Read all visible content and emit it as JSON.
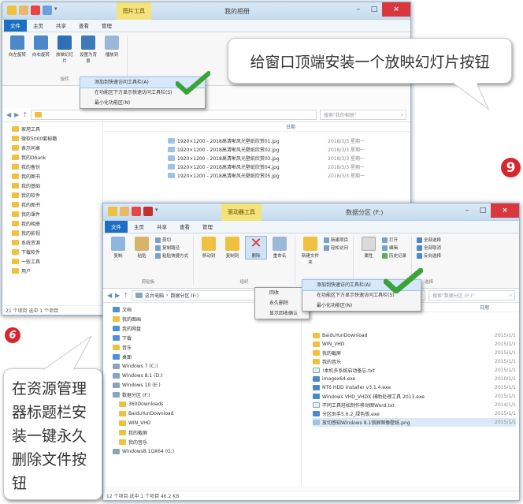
{
  "back_window": {
    "tool_tab": "图片工具",
    "title": "我的相册",
    "tabs": [
      "文件",
      "主页",
      "共享",
      "查看",
      "管理"
    ],
    "ribbon_buttons": [
      {
        "label": "向左旋转",
        "icon": "rotate-left-icon"
      },
      {
        "label": "向右旋转",
        "icon": "rotate-right-icon"
      },
      {
        "label": "放映幻灯片",
        "icon": "slideshow-icon"
      },
      {
        "label": "设置为背景",
        "icon": "set-background-icon"
      },
      {
        "label": "播放到",
        "icon": "play-to-icon"
      }
    ],
    "ribbon_group": "旋转",
    "context_menu": [
      "添加到快速访问工具栏(A)",
      "在功能区下方显示快速访问工具栏(S)",
      "最小化功能区(N)"
    ],
    "search_placeholder": "搜索\"我的相册\"",
    "date_header": "日期",
    "nav_items": [
      "家用工具",
      "微软5000套秘籍",
      "表示同桌",
      "我的Dbank",
      "我的备份",
      "我的图书",
      "我的基础",
      "我的软件",
      "我的图书",
      "我的课件",
      "我的相册",
      "我的影视",
      "系统资源",
      "下载软件",
      "一些工具",
      "用户"
    ],
    "files": [
      {
        "name": "1920×1200 - 2018高清晰风光壁纸欣赏01.jpg",
        "date": "2018/3/3 星期一"
      },
      {
        "name": "1920×1200 - 2018高清晰风光壁纸欣赏02.jpg",
        "date": "2018/3/3 星期一"
      },
      {
        "name": "1920×1200 - 2018高清晰风光壁纸欣赏03.jpg",
        "date": "2018/3/3 星期一"
      },
      {
        "name": "1920×1200 - 2018高清晰风光壁纸欣赏04.jpg",
        "date": "2018/3/3 星期一"
      },
      {
        "name": "1920×1200 - 2018高清晰风光壁纸欣赏05.jpg",
        "date": "2018/3/3 星期一"
      }
    ],
    "status": "21 个项目    选中 1 个项目"
  },
  "front_window": {
    "tool_tab": "驱动器工具",
    "title": "数据分区 (F:)",
    "tabs": [
      "文件",
      "主页",
      "共享",
      "查看",
      "管理"
    ],
    "ribbon": {
      "clipboard": {
        "label": "剪贴板",
        "buttons": [
          "复制",
          "粘贴"
        ],
        "small": [
          "剪切",
          "复制路径",
          "粘贴快捷方式"
        ]
      },
      "organize": {
        "label": "组织",
        "buttons": [
          "移动到",
          "复制到",
          "删除",
          "重命名"
        ]
      },
      "new": {
        "label": "新建",
        "buttons": [
          "新建文件夹"
        ],
        "small": [
          "新建项目",
          "轻松访问"
        ]
      },
      "open": {
        "label": "打开",
        "buttons": [
          "属性"
        ],
        "small": [
          "打开",
          "编辑",
          "历史记录"
        ]
      },
      "select": {
        "label": "选择",
        "small": [
          "全部选择",
          "全部取消",
          "反向选择"
        ]
      }
    },
    "delete_menu": [
      "回收",
      "永久删除",
      "显示回收确认"
    ],
    "context_menu": [
      "添加到快速访问工具栏(A)",
      "在功能区下方显示快速访问工具栏(S)",
      "最小化功能区(N)"
    ],
    "breadcrumb": [
      "这台电脑",
      "数据分区 (F:)"
    ],
    "search_placeholder": "搜索\"数据分区 (F:)\"",
    "date_header": "日期",
    "nav_items": [
      {
        "label": "文档",
        "kind": "blue",
        "level": 1
      },
      {
        "label": "我的图画",
        "kind": "yellow",
        "level": 1
      },
      {
        "label": "我的网盘",
        "kind": "blue",
        "level": 1
      },
      {
        "label": "下载",
        "kind": "blue",
        "level": 1
      },
      {
        "label": "音乐",
        "kind": "yellow",
        "level": 1
      },
      {
        "label": "桌面",
        "kind": "blue",
        "level": 1
      },
      {
        "label": "Windows 7 (C:)",
        "kind": "drive",
        "level": 1
      },
      {
        "label": "Windows 8.1 (D:)",
        "kind": "drive",
        "level": 1
      },
      {
        "label": "Windows 10 (E:)",
        "kind": "drive",
        "level": 1
      },
      {
        "label": "数据分区 (F:)",
        "kind": "drive",
        "level": 1
      },
      {
        "label": "360Downloads",
        "kind": "yellow",
        "level": 2
      },
      {
        "label": "BaiduYunDownload",
        "kind": "yellow",
        "level": 2
      },
      {
        "label": "WIN_VHD",
        "kind": "yellow",
        "level": 2
      },
      {
        "label": "我的截屏",
        "kind": "yellow",
        "level": 2
      },
      {
        "label": "我的音乐",
        "kind": "yellow",
        "level": 2
      },
      {
        "label": "Windows8.1QX64 (G:)",
        "kind": "drive",
        "level": 1
      }
    ],
    "files": [
      {
        "name": "BaiduYunDownload",
        "date": "2015/1/1",
        "kind": "yellow"
      },
      {
        "name": "WIN_VHD",
        "date": "2015/1/1",
        "kind": "yellow"
      },
      {
        "name": "我的截屏",
        "date": "2015/1/1",
        "kind": "yellow"
      },
      {
        "name": "我的音乐",
        "date": "2015/1/1",
        "kind": "yellow"
      },
      {
        "name": "!本机多系统启动备忘.txt",
        "date": "2015/1/1",
        "kind": "doc"
      },
      {
        "name": "imagex64.exe",
        "date": "2010/1/1",
        "kind": "exe"
      },
      {
        "name": "NT6 HDD Installer v3.1.4.exe",
        "date": "2015/1/1",
        "kind": "exe"
      },
      {
        "name": "Windows VHD_VHDX 辅助处理工具 2013.exe",
        "date": "2015/1/1",
        "kind": "exe"
      },
      {
        "name": "不同工具轻松制作移动图Word.txt",
        "date": "2014/1/1",
        "kind": "doc"
      },
      {
        "name": "分区助手5.6.2_绿色版.exe",
        "date": "2015/1/1",
        "kind": "exe"
      },
      {
        "name": "放切感知Windows 8.1锁屏图像壁纸.png",
        "date": "2015/1/1",
        "kind": "img"
      }
    ],
    "status": "12 个项目    选中 1 个项目  46.2 KB"
  },
  "callouts": {
    "top": "给窗口顶端安装一个放映幻灯片按钮",
    "bottom": "在资源管理器标题栏安装一键永久删除文件按钮"
  },
  "badges": {
    "red": "9",
    "red_small": "6"
  },
  "colors": {
    "file_tab": "#1e6fc4",
    "tool_tab": "#f4e27a",
    "close": "#d9363e",
    "check": "#3aa33a",
    "badge": "#d7262c"
  }
}
